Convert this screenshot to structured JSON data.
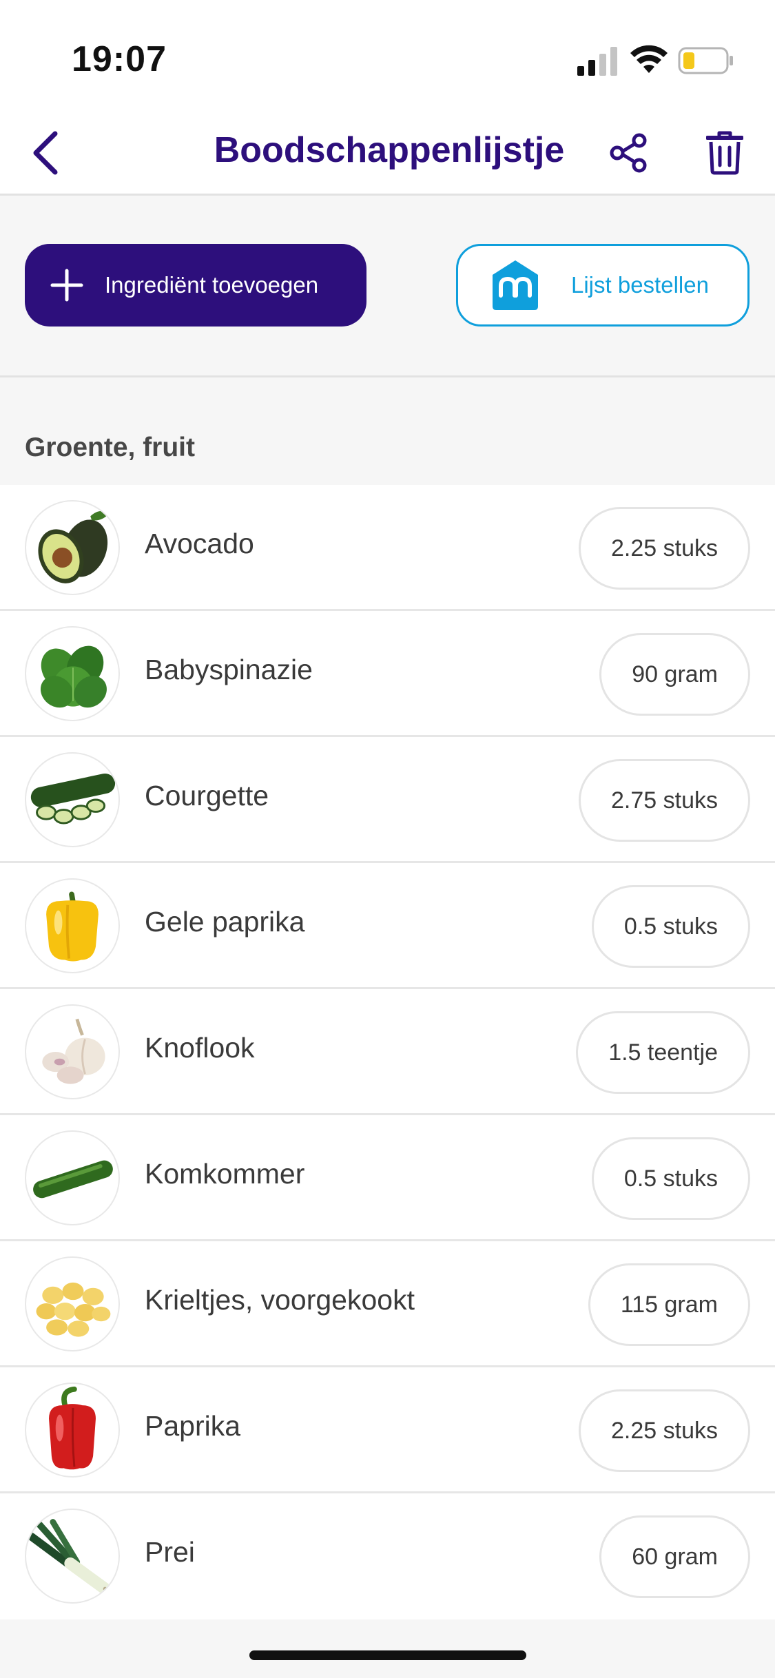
{
  "status_bar": {
    "time": "19:07",
    "icons": [
      "signal-icon",
      "wifi-icon",
      "battery-icon"
    ],
    "battery_color": "#f4c81b"
  },
  "nav": {
    "title": "Boodschappenlijstje",
    "back_icon": "chevron-left-icon",
    "share_icon": "share-icon",
    "delete_icon": "trash-icon"
  },
  "actions": {
    "add_label": "Ingrediënt toevoegen",
    "add_icon": "plus-icon",
    "order_label": "Lijst bestellen",
    "order_icon": "albert-heijn-logo-icon"
  },
  "colors": {
    "brand_purple": "#2d0f7c",
    "ah_blue": "#0f9fdc"
  },
  "section": {
    "title": "Groente, fruit"
  },
  "items": [
    {
      "name": "Avocado",
      "quantity": "2.25 stuks",
      "image": "avocado"
    },
    {
      "name": "Babyspinazie",
      "quantity": "90 gram",
      "image": "spinach"
    },
    {
      "name": "Courgette",
      "quantity": "2.75 stuks",
      "image": "zucchini"
    },
    {
      "name": "Gele paprika",
      "quantity": "0.5 stuks",
      "image": "yellow-pepper"
    },
    {
      "name": "Knoflook",
      "quantity": "1.5 teentje",
      "image": "garlic"
    },
    {
      "name": "Komkommer",
      "quantity": "0.5 stuks",
      "image": "cucumber"
    },
    {
      "name": "Krieltjes, voorgekookt",
      "quantity": "115 gram",
      "image": "potatoes"
    },
    {
      "name": "Paprika",
      "quantity": "2.25 stuks",
      "image": "red-pepper"
    },
    {
      "name": "Prei",
      "quantity": "60 gram",
      "image": "leek"
    }
  ]
}
